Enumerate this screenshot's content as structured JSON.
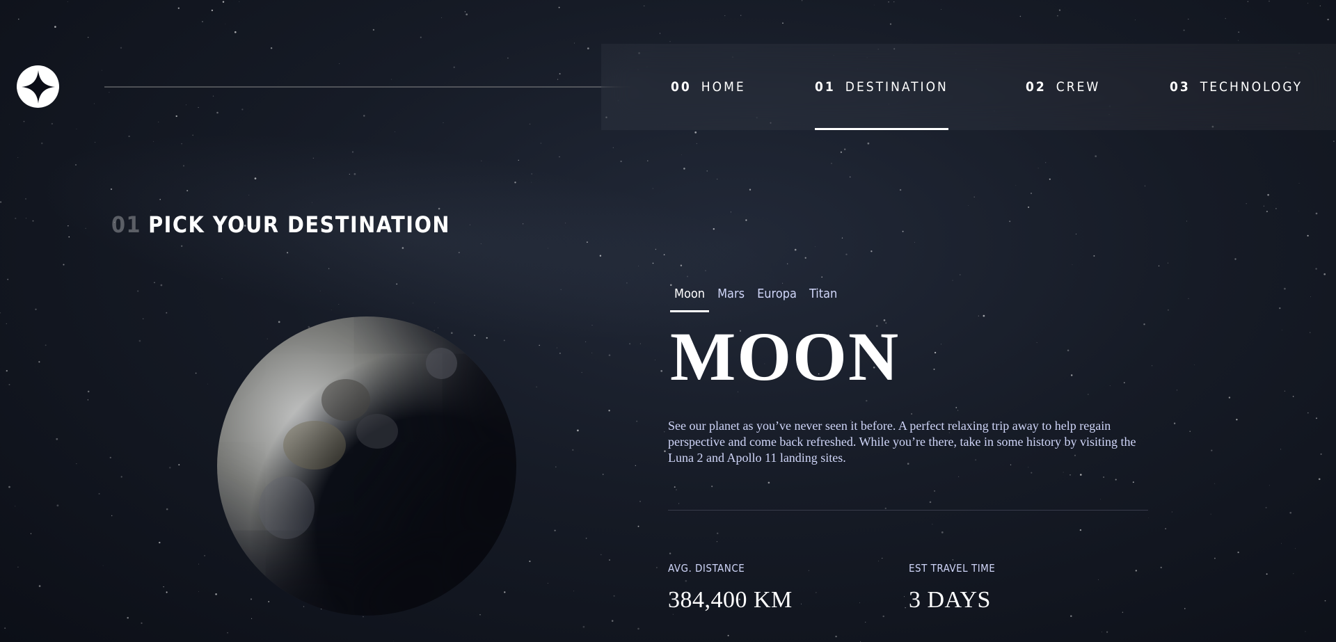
{
  "header": {
    "logo_icon": "star-logo-icon",
    "nav": [
      {
        "num": "00",
        "label": "HOME"
      },
      {
        "num": "01",
        "label": "DESTINATION"
      },
      {
        "num": "02",
        "label": "CREW"
      },
      {
        "num": "03",
        "label": "TECHNOLOGY"
      }
    ],
    "active_nav": "DESTINATION"
  },
  "page": {
    "heading_index": "01",
    "heading_text": "PICK YOUR DESTINATION"
  },
  "destination": {
    "tabs": [
      "Moon",
      "Mars",
      "Europa",
      "Titan"
    ],
    "active_tab": "Moon",
    "name": "MOON",
    "description": "See our planet as you’ve never seen it before. A perfect relaxing trip away to help regain perspective and come back refreshed. While you’re there, take in some history by visiting the Luna 2 and Apollo 11 landing sites.",
    "stats": {
      "distance_label": "AVG. DISTANCE",
      "distance_value": "384,400 KM",
      "travel_label": "EST TRAVEL TIME",
      "travel_value": "3 DAYS"
    },
    "image_icon": "moon-planet-image"
  },
  "colors": {
    "background": "#0b0d17",
    "accent_text": "#d0d6f9",
    "white": "#ffffff"
  }
}
